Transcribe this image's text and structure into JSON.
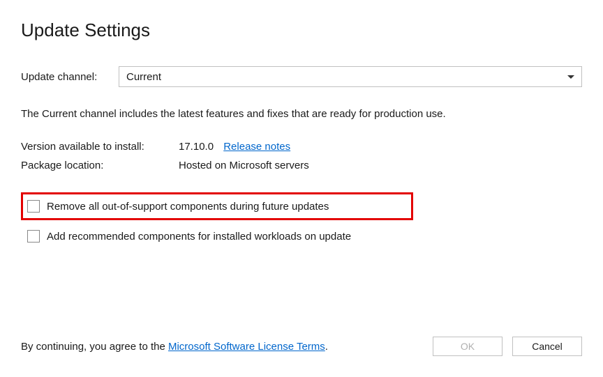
{
  "title": "Update Settings",
  "channel": {
    "label": "Update channel:",
    "value": "Current"
  },
  "description": "The Current channel includes the latest features and fixes that are ready for production use.",
  "version": {
    "label": "Version available to install:",
    "value": "17.10.0",
    "release_notes_link": "Release notes"
  },
  "package_location": {
    "label": "Package location:",
    "value": "Hosted on Microsoft servers"
  },
  "checkboxes": {
    "remove_oos": "Remove all out-of-support components during future updates",
    "add_recommended": "Add recommended components for installed workloads on update"
  },
  "footer": {
    "prefix": "By continuing, you agree to the ",
    "license_link": "Microsoft Software License Terms",
    "suffix": ".",
    "ok": "OK",
    "cancel": "Cancel"
  }
}
